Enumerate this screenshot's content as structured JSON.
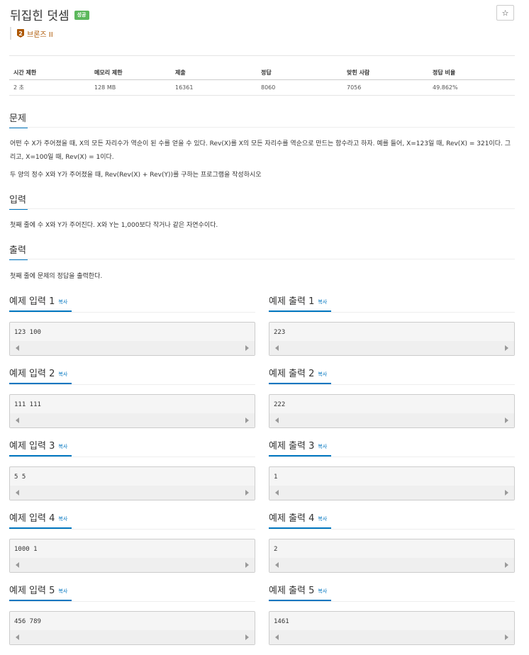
{
  "problem": {
    "title": "뒤집힌 덧셈",
    "status_badge": "성공",
    "tier": "브론즈 II",
    "tier_number": "2",
    "star": "☆"
  },
  "info_table": {
    "headers": [
      "시간 제한",
      "메모리 제한",
      "제출",
      "정답",
      "맞힌 사람",
      "정답 비율"
    ],
    "values": [
      "2 초",
      "128 MB",
      "16361",
      "8060",
      "7056",
      "49.862%"
    ]
  },
  "sections": {
    "description_title": "문제",
    "description_p1": "어떤 수 X가 주어졌을 때, X의 모든 자리수가 역순이 된 수를 얻을 수 있다. Rev(X)를 X의 모든 자리수를 역순으로 만드는 함수라고 하자. 예를 들어, X=123일 때, Rev(X) = 321이다. 그리고, X=100일 때, Rev(X) = 1이다.",
    "description_p2": "두 양의 정수 X와 Y가 주어졌을 때, Rev(Rev(X) + Rev(Y))를 구하는 프로그램을 작성하시오",
    "input_title": "입력",
    "input_text": "첫째 줄에 수 X와 Y가 주어진다. X와 Y는 1,000보다 작거나 같은 자연수이다.",
    "output_title": "출력",
    "output_text": "첫째 줄에 문제의 정답을 출력한다."
  },
  "copy_label": "복사",
  "samples": [
    {
      "input_title": "예제 입력 1",
      "input": "123 100",
      "output_title": "예제 출력 1",
      "output": "223"
    },
    {
      "input_title": "예제 입력 2",
      "input": "111 111",
      "output_title": "예제 출력 2",
      "output": "222"
    },
    {
      "input_title": "예제 입력 3",
      "input": "5 5",
      "output_title": "예제 출력 3",
      "output": "1"
    },
    {
      "input_title": "예제 입력 4",
      "input": "1000 1",
      "output_title": "예제 출력 4",
      "output": "2"
    },
    {
      "input_title": "예제 입력 5",
      "input": "456 789",
      "output_title": "예제 출력 5",
      "output": "1461"
    }
  ]
}
